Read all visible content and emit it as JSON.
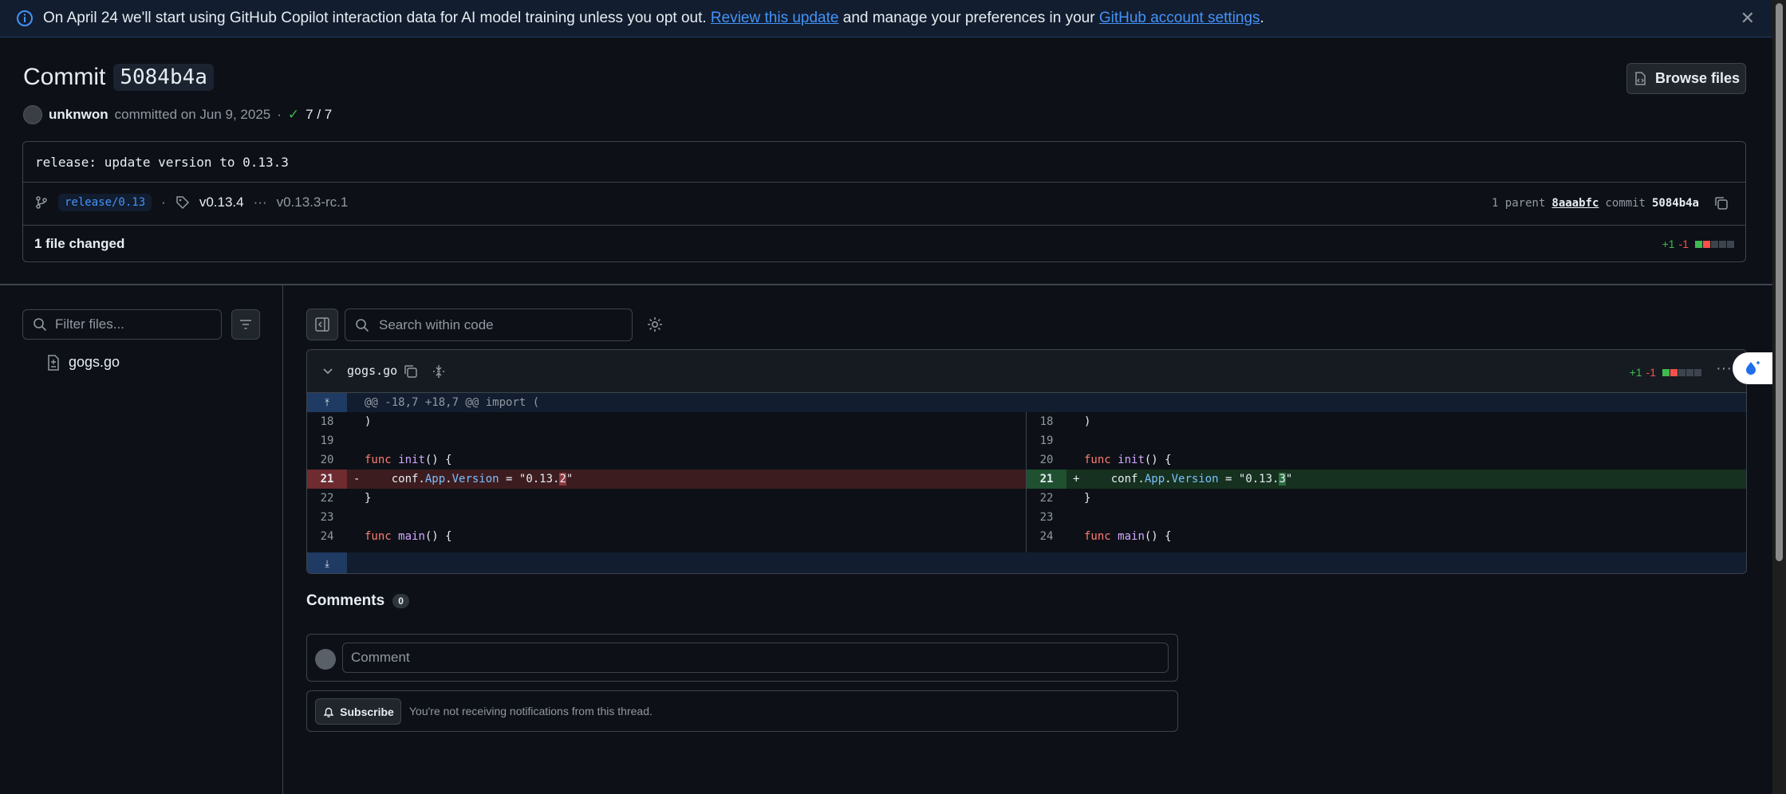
{
  "banner": {
    "text_before": "On April 24 we'll start using GitHub Copilot interaction data for AI model training unless you opt out. ",
    "link1": "Review this update",
    "text_middle": " and manage your preferences in your ",
    "link2": "GitHub account settings",
    "text_after": ".",
    "close": "✕"
  },
  "commit": {
    "title_word": "Commit",
    "sha": "5084b4a",
    "browse_label": "Browse files",
    "author": "unknwon",
    "committed_on": "committed on Jun 9, 2025",
    "sep": "·",
    "checks": "7 / 7",
    "message": "release: update version to 0.13.3",
    "branch": "release/0.13",
    "tag": "v0.13.4",
    "tag_more": "···",
    "tag_prev": "v0.13.3-rc.1",
    "parent_label": "1 parent",
    "parent_sha": "8aaabfc",
    "commit_label": "commit",
    "commit_sha": "5084b4a",
    "files_changed": "1 file changed",
    "additions": "+1",
    "deletions": "-1"
  },
  "sidebar": {
    "filter_placeholder": "Filter files...",
    "file": "gogs.go"
  },
  "diff": {
    "search_placeholder": "Search within code",
    "filename": "gogs.go",
    "additions": "+1",
    "deletions": "-1",
    "hunk_header": "@@ -18,7 +18,7 @@ import (",
    "left": [
      {
        "num": "18",
        "type": "ctx",
        "code": ")"
      },
      {
        "num": "19",
        "type": "ctx",
        "code": ""
      },
      {
        "num": "20",
        "type": "ctx",
        "code": "func init() {"
      },
      {
        "num": "21",
        "type": "del",
        "sign": "-",
        "code": "    conf.App.Version = \"0.13.2\""
      },
      {
        "num": "22",
        "type": "ctx",
        "code": "}"
      },
      {
        "num": "23",
        "type": "ctx",
        "code": ""
      },
      {
        "num": "24",
        "type": "ctx",
        "code": "func main() {"
      }
    ],
    "right": [
      {
        "num": "18",
        "type": "ctx",
        "code": ")"
      },
      {
        "num": "19",
        "type": "ctx",
        "code": ""
      },
      {
        "num": "20",
        "type": "ctx",
        "code": "func init() {"
      },
      {
        "num": "21",
        "type": "add",
        "sign": "+",
        "code": "    conf.App.Version = \"0.13.3\""
      },
      {
        "num": "22",
        "type": "ctx",
        "code": "}"
      },
      {
        "num": "23",
        "type": "ctx",
        "code": ""
      },
      {
        "num": "24",
        "type": "ctx",
        "code": "func main() {"
      }
    ]
  },
  "comments": {
    "title": "Comments",
    "count": "0",
    "placeholder": "Comment",
    "subscribe_label": "Subscribe",
    "subscribe_text": "You're not receiving notifications from this thread."
  },
  "colors": {
    "accent": "#4493f8",
    "addition": "#3fb950",
    "deletion": "#f85149",
    "background": "#0d1117"
  }
}
